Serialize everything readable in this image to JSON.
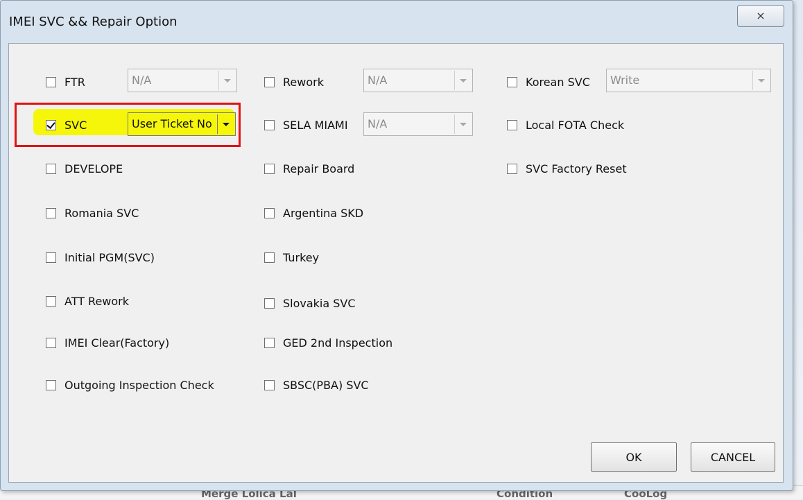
{
  "dialog": {
    "title": "IMEI SVC && Repair Option",
    "close_glyph": "⨯"
  },
  "options": {
    "col1": [
      {
        "label": "FTR",
        "checked": false
      },
      {
        "label": "SVC",
        "checked": true
      },
      {
        "label": "DEVELOPE",
        "checked": false
      },
      {
        "label": "Romania SVC",
        "checked": false
      },
      {
        "label": "Initial PGM(SVC)",
        "checked": false
      },
      {
        "label": "ATT Rework",
        "checked": false
      },
      {
        "label": "IMEI Clear(Factory)",
        "checked": false
      },
      {
        "label": "Outgoing Inspection Check",
        "checked": false
      }
    ],
    "col2": [
      {
        "label": "Rework",
        "checked": false
      },
      {
        "label": "SELA MIAMI",
        "checked": false
      },
      {
        "label": "Repair Board",
        "checked": false
      },
      {
        "label": "Argentina SKD",
        "checked": false
      },
      {
        "label": "Turkey",
        "checked": false
      },
      {
        "label": "Slovakia SVC",
        "checked": false
      },
      {
        "label": "GED 2nd Inspection",
        "checked": false
      },
      {
        "label": "SBSC(PBA) SVC",
        "checked": false
      }
    ],
    "col3": [
      {
        "label": "Korean SVC",
        "checked": false
      },
      {
        "label": "Local FOTA Check",
        "checked": false
      },
      {
        "label": "SVC Factory Reset",
        "checked": false
      }
    ]
  },
  "combos": {
    "ftr": "N/A",
    "svc": "User Ticket No",
    "rework": "N/A",
    "sela_miami": "N/A",
    "korean_svc": "Write"
  },
  "buttons": {
    "ok": "OK",
    "cancel": "CANCEL"
  },
  "background": {
    "bottom_text_1": "Merge Lolica Lal",
    "bottom_text_2": "Condition",
    "bottom_text_3": "CooLog"
  },
  "colors": {
    "highlight": "#f6f60a",
    "annotation_box": "#e01313"
  }
}
